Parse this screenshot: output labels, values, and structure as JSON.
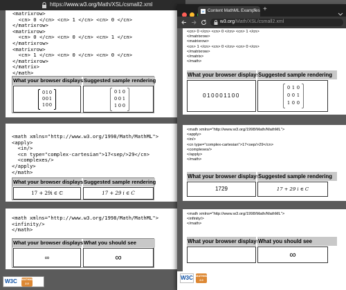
{
  "back": {
    "url_prefix": "https://",
    "url_domain": "www.w3.org",
    "url_path": "/Math/XSL/csmall2.xml",
    "code1": "<matrixrow>\n  <cn> 0 </cn> <cn> 1 </cn> <cn> 0 </cn>\n</matrixrow>\n<matrixrow>\n  <cn> 0 </cn> <cn> 0 </cn> <cn> 1 </cn>\n</matrixrow>\n<matrixrow>\n  <cn> 1 </cn> <cn> 0 </cn> <cn> 0 </cn>\n</matrixrow>\n</matrix>\n</math>",
    "header_left": "What your browser displays",
    "header_right": "Suggested sample rendering",
    "code2": "<math xmlns=\"http://www.w3.org/1998/Math/MathML\">\n<apply>\n  <in/>\n  <cn type=\"complex-cartesian\">17<sep/>29</cn>\n  <complexes/>\n</apply>\n</math>",
    "complex_display": "17 + 29i ∈ ℂ",
    "complex_sample": "17 + 29 i ∈ C",
    "code3": "<math xmlns=\"http://www.w3.org/1998/Math/MathML\">\n<infinity/>\n</math>",
    "header_left3": "What your browser displays",
    "header_right3": "What you should see",
    "infinity_display": "∞",
    "infinity_sample": "∞"
  },
  "front": {
    "tab_title": "Content MathML Examples",
    "tab_new": "+",
    "url_domain": "w3.org",
    "url_path": "/Math/XSL/csmall2.xml",
    "code1": "<cn> 0 </cn> <cn> 0 </cn> <cn> 1 </cn>\n</matrixrow>\n<matrixrow>\n<cn> 1 </cn> <cn> 0 </cn> <cn> 0 </cn>\n</matrixrow>\n</matrix>\n</math>",
    "header_left": "What your browser displays",
    "header_right": "Suggested sample rendering",
    "matrix_flat": "010001100",
    "code2": "<math xmlns=\"http://www.w3.org/1998/Math/MathML\">\n<apply>\n<in/>\n<cn type=\"complex-cartesian\">17<sep/>29</cn>\n<complexes/>\n</apply>\n</math>",
    "complex_display": "1729",
    "complex_sample": "17 + 29 i ∈ C",
    "code3": "<math xmlns=\"http://www.w3.org/1998/Math/MathML\">\n<infinity/>\n</math>",
    "header_right3": "What you should see",
    "infinity_display": "",
    "infinity_sample": "∞"
  },
  "matrix": [
    [
      "0",
      "1",
      "0"
    ],
    [
      "0",
      "0",
      "1"
    ],
    [
      "1",
      "0",
      "0"
    ]
  ],
  "badges": {
    "w3c": "W3C",
    "mathml": "MATHML",
    "mathml_ver": "2.0"
  },
  "colors": {
    "header_bg": "#c8c8c8",
    "chrome_dark": "#1f1f1f",
    "page_bg": "#5b5b5b"
  }
}
